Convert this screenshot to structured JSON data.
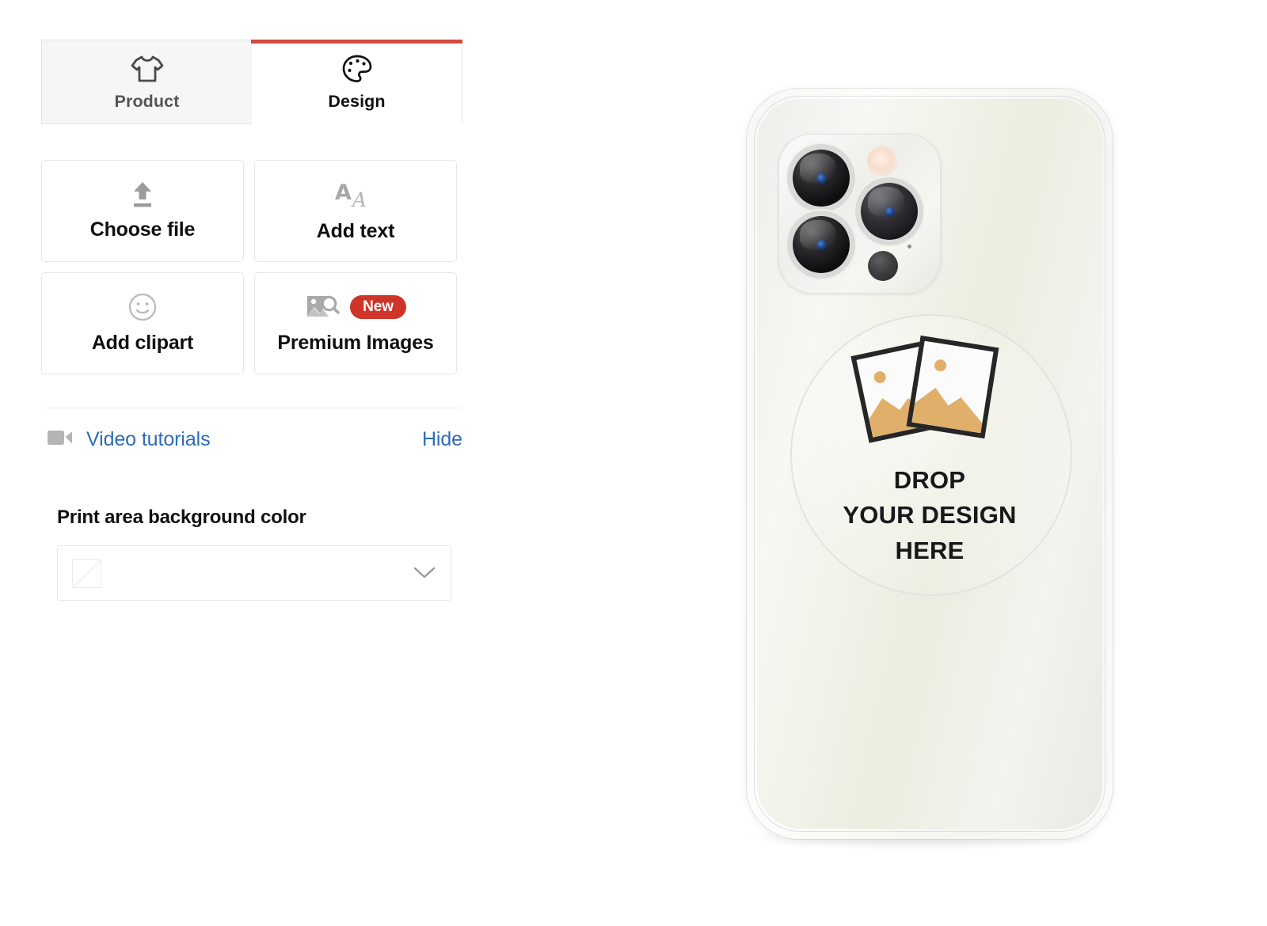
{
  "tabs": [
    {
      "id": "product",
      "label": "Product",
      "icon": "tshirt-icon",
      "active": false
    },
    {
      "id": "design",
      "label": "Design",
      "icon": "palette-icon",
      "active": true
    }
  ],
  "actions": [
    {
      "id": "choose-file",
      "label": "Choose file",
      "icon": "upload-icon"
    },
    {
      "id": "add-text",
      "label": "Add text",
      "icon": "font-aa-icon"
    },
    {
      "id": "add-clipart",
      "label": "Add clipart",
      "icon": "smiley-icon"
    },
    {
      "id": "premium-images",
      "label": "Premium Images",
      "icon": "image-search-icon",
      "badge": "New"
    }
  ],
  "tutorials": {
    "icon": "video-camera-icon",
    "label": "Video tutorials",
    "hide_label": "Hide"
  },
  "print_background": {
    "label": "Print area background color",
    "selected_swatch": "none",
    "chevron": "chevron-down-icon"
  },
  "preview": {
    "product": "phone-case-mockup",
    "drop_zone": {
      "icon": "two-photos-icon",
      "lines": [
        "DROP",
        "YOUR DESIGN",
        "HERE"
      ]
    }
  },
  "colors": {
    "accent_red": "#d64a3f",
    "badge_red": "#cf3429",
    "link_blue": "#2d6cb5",
    "photo_gold": "#e0b06a",
    "text_dark": "#111111",
    "muted_gray": "#aaaaaa"
  }
}
